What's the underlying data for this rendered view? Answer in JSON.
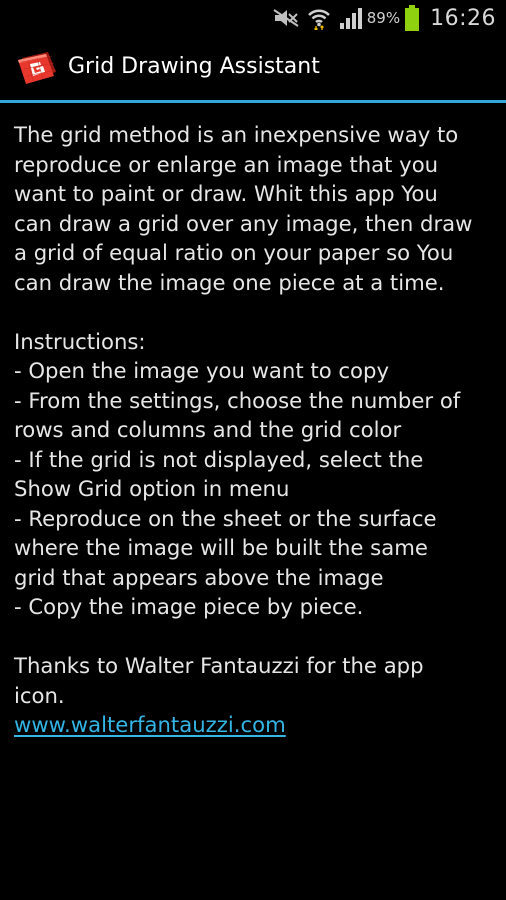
{
  "status_bar": {
    "battery_percent": "89%",
    "battery_level": 0.89,
    "time": "16:26"
  },
  "app_bar": {
    "title": "Grid Drawing Assistant",
    "icon": "grid-app-icon"
  },
  "content": {
    "intro_lines": [
      "The grid method is an inexpensive way to",
      "reproduce or enlarge an image that you",
      "want to paint or draw. Whit this app You",
      "can draw a grid over any image, then draw",
      "a grid of equal ratio on your paper so You",
      "can draw the image one piece at a time."
    ],
    "instructions_lines": [
      "Instructions:",
      "- Open the image you want to copy",
      "- From the settings, choose the number of",
      "rows and columns and the grid color",
      "- If the grid is not displayed, select the",
      "Show Grid option in menu",
      "- Reproduce on the sheet or the surface",
      "where the image will be built the same",
      "grid that appears above the image",
      "- Copy the image piece by piece."
    ],
    "thanks_lines": [
      "Thanks to Walter Fantauzzi for the app",
      "icon."
    ],
    "link": "www.walterfantauzzi.com"
  },
  "colors": {
    "accent": "#33b5e5",
    "background": "#000000",
    "text": "#e6e6e6"
  }
}
